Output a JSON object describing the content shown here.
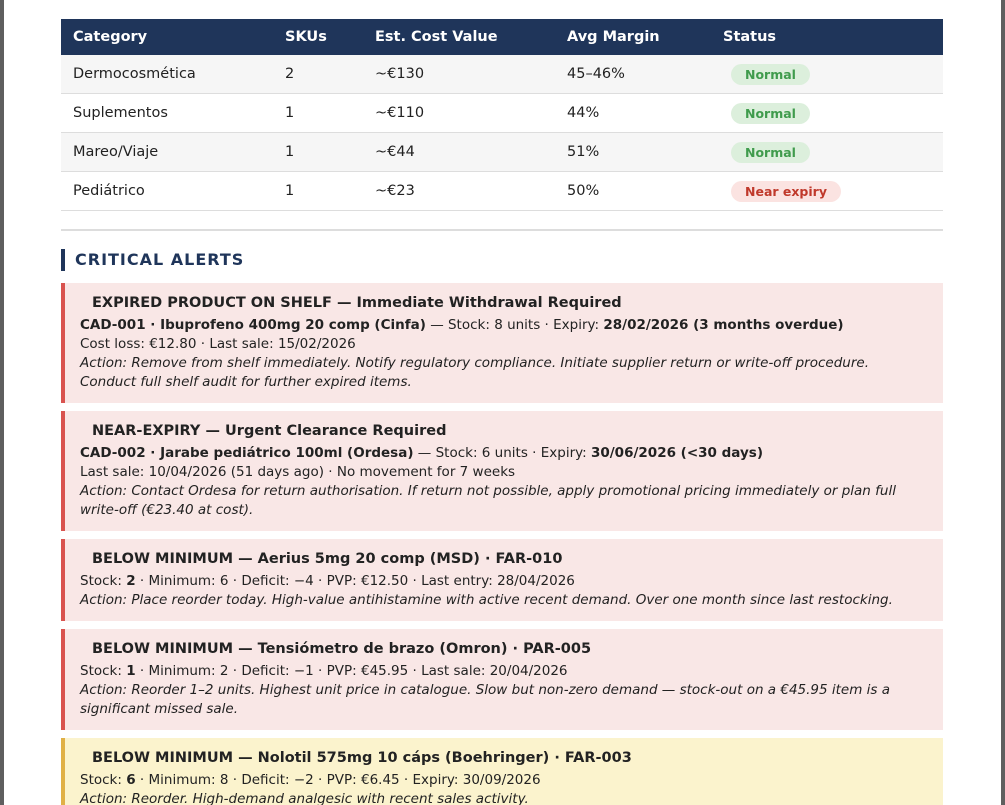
{
  "table": {
    "headers": [
      "Category",
      "SKUs",
      "Est. Cost Value",
      "Avg Margin",
      "Status"
    ],
    "rows": [
      {
        "category": "Dermocosmética",
        "skus": "2",
        "cost": "~€130",
        "margin": "45–46%",
        "status": "Normal"
      },
      {
        "category": "Suplementos",
        "skus": "1",
        "cost": "~€110",
        "margin": "44%",
        "status": "Normal"
      },
      {
        "category": "Mareo/Viaje",
        "skus": "1",
        "cost": "~€44",
        "margin": "51%",
        "status": "Normal"
      },
      {
        "category": "Pediátrico",
        "skus": "1",
        "cost": "~€23",
        "margin": "50%",
        "status": "Near expiry"
      }
    ]
  },
  "section_title": "CRITICAL ALERTS",
  "alerts": [
    {
      "title": "EXPIRED PRODUCT ON SHELF — Immediate Withdrawal Required",
      "l1_bold": "CAD-001 · Ibuprofeno 400mg 20 comp (Cinfa)",
      "l1_mid": " — Stock: 8 units · Expiry: ",
      "l1_bold2": "28/02/2026 (3 months overdue)",
      "l2": "Cost loss: €12.80 · Last sale: 15/02/2026",
      "action": "Action: Remove from shelf immediately. Notify regulatory compliance. Initiate supplier return or write-off procedure. Conduct full shelf audit for further expired items."
    },
    {
      "title": "NEAR-EXPIRY — Urgent Clearance Required",
      "l1_bold": "CAD-002 · Jarabe pediátrico 100ml (Ordesa)",
      "l1_mid": " — Stock: 6 units · Expiry: ",
      "l1_bold2": "30/06/2026 (<30 days)",
      "l2": "Last sale: 10/04/2026 (51 days ago) · No movement for 7 weeks",
      "action": "Action: Contact Ordesa for return authorisation. If return not possible, apply promotional pricing immediately or plan full write-off (€23.40 at cost)."
    },
    {
      "title": "BELOW MINIMUM — Aerius 5mg 20 comp (MSD) · FAR-010",
      "stock_label": "Stock: ",
      "stock": "2",
      "rest": " · Minimum: 6 · Deficit: −4 · PVP: €12.50 · Last entry: 28/04/2026",
      "action": "Action: Place reorder today. High-value antihistamine with active recent demand. Over one month since last restocking."
    },
    {
      "title": "BELOW MINIMUM — Tensiómetro de brazo (Omron) · PAR-005",
      "stock_label": "Stock: ",
      "stock": "1",
      "rest": " · Minimum: 2 · Deficit: −1 · PVP: €45.95 · Last sale: 20/04/2026",
      "action": "Action: Reorder 1–2 units. Highest unit price in catalogue. Slow but non-zero demand — stock-out on a €45.95 item is a significant missed sale."
    },
    {
      "title": "BELOW MINIMUM — Nolotil 575mg 10 cáps (Boehringer) · FAR-003",
      "stock_label": "Stock: ",
      "stock": "6",
      "rest": " · Minimum: 8 · Deficit: −2 · PVP: €6.45 · Expiry: 30/09/2026",
      "action": "Action: Reorder. High-demand analgesic with recent sales activity."
    }
  ]
}
